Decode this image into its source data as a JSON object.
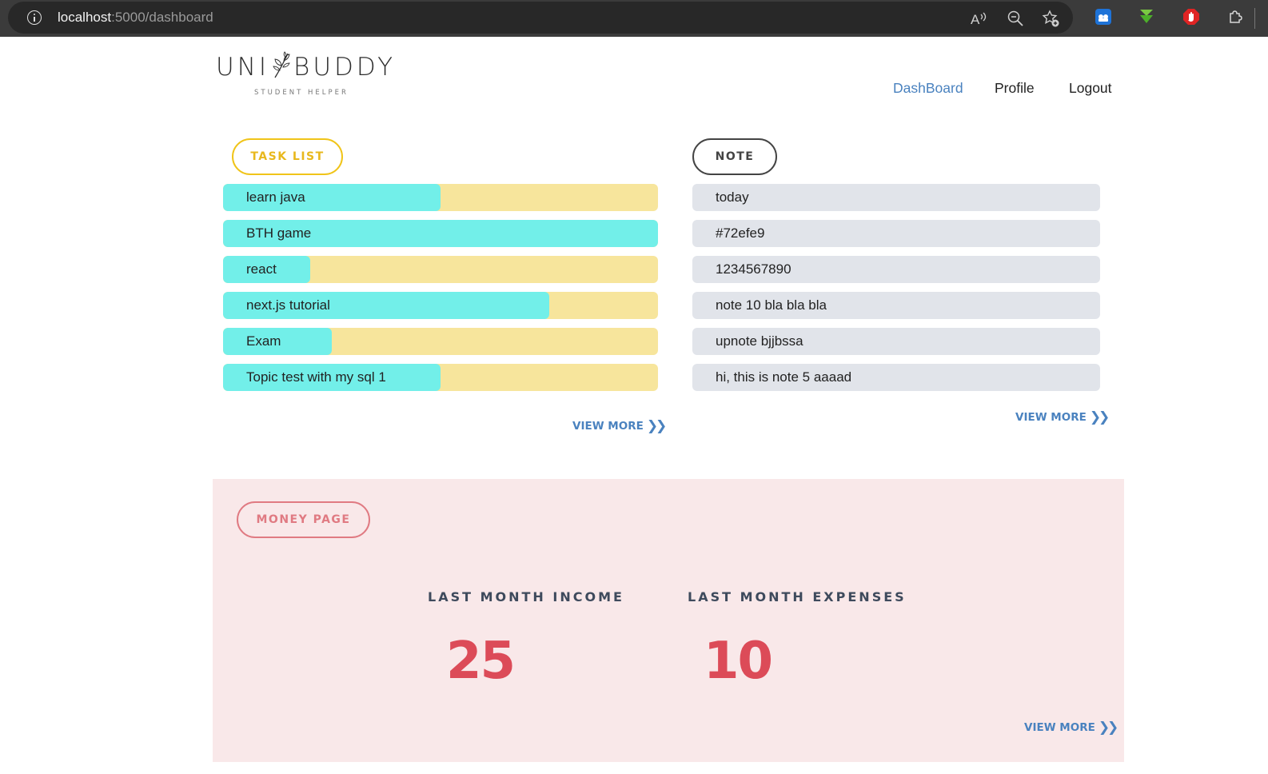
{
  "browser": {
    "url_host": "localhost",
    "url_path": ":5000/dashboard",
    "icons": [
      "info-icon",
      "read-aloud-icon",
      "zoom-out-icon",
      "add-favorite-icon",
      "translate-extension-icon",
      "download-extension-icon",
      "adblock-extension-icon",
      "extensions-icon"
    ]
  },
  "header": {
    "logo_left": "UNI",
    "logo_right": "BUDDY",
    "logo_tagline": "STUDENT HELPER",
    "nav": [
      "DashBoard",
      "Profile",
      "Logout"
    ],
    "active_nav": "DashBoard"
  },
  "tasks": {
    "title": "TASK LIST",
    "items": [
      {
        "label": "learn java",
        "progress": 0.5
      },
      {
        "label": "BTH game",
        "progress": 1.0
      },
      {
        "label": "react",
        "progress": 0.2
      },
      {
        "label": "next.js tutorial",
        "progress": 0.75
      },
      {
        "label": "Exam",
        "progress": 0.25
      },
      {
        "label": "Topic test with my sql 1",
        "progress": 0.5
      }
    ],
    "view_more": "VIEW MORE"
  },
  "notes": {
    "title": "NOTE",
    "items": [
      "today",
      "#72efe9",
      "1234567890",
      "note 10 bla bla bla",
      "upnote bjjbssa",
      "hi, this is note 5 aaaad"
    ],
    "view_more": "VIEW MORE"
  },
  "money": {
    "title": "MONEY PAGE",
    "income_label": "LAST MONTH INCOME",
    "income_value": "25",
    "expenses_label": "LAST MONTH EXPENSES",
    "expenses_value": "10",
    "view_more": "VIEW MORE"
  },
  "colors": {
    "progress_fill": "#72efe9",
    "progress_track": "#f7e59c",
    "note_bg": "#e1e4ea",
    "accent_link": "#4a82bf",
    "money_bg": "#f9e8e9",
    "money_value": "#dc4b58",
    "task_pill": "#f0c419"
  }
}
